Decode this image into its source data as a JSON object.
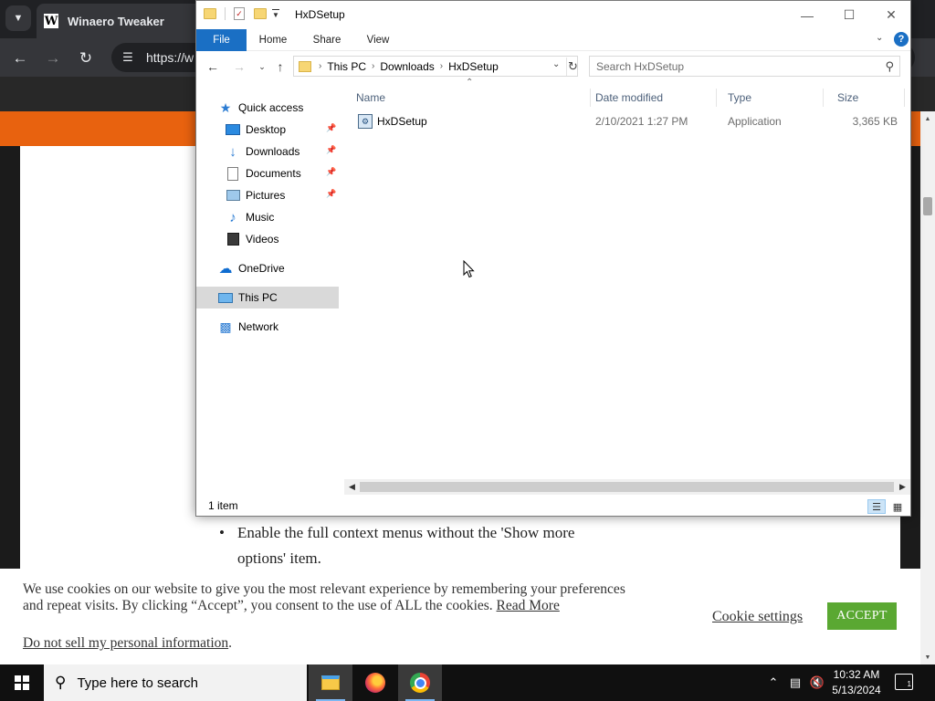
{
  "browser": {
    "tab_title": "Winaero Tweaker",
    "tab_logo_letter": "W",
    "url": "https://w",
    "nav_icons": [
      "back-arrow-icon",
      "forward-arrow-icon",
      "reload-icon",
      "site-info-icon"
    ]
  },
  "webpage": {
    "bullets": [
      "Enable the full context menus without the 'Show more options' item."
    ]
  },
  "cookie": {
    "text": "We use cookies on our website to give you the most relevant experience by remembering your preferences and repeat visits. By clicking “Accept”, you consent to the use of ALL the cookies.",
    "read_more": "Read More",
    "period": ".",
    "do_not_sell": "Do not sell my personal information",
    "settings": "Cookie settings",
    "accept": "ACCEPT",
    "accept_color": "#5aa832"
  },
  "explorer": {
    "title": "HxDSetup",
    "ribbon_tabs": [
      "File",
      "Home",
      "Share",
      "View"
    ],
    "file_tab_color": "#1a6fc4",
    "help_glyph": "?",
    "breadcrumb": [
      "This PC",
      "Downloads",
      "HxDSetup"
    ],
    "search_placeholder": "Search HxDSetup",
    "nav_pane": [
      {
        "label": "Quick access",
        "icon": "star-icon",
        "pinned": false,
        "selected": false
      },
      {
        "label": "Desktop",
        "icon": "desktop-icon",
        "pinned": true,
        "selected": false
      },
      {
        "label": "Downloads",
        "icon": "download-arrow-icon",
        "pinned": true,
        "selected": false
      },
      {
        "label": "Documents",
        "icon": "document-icon",
        "pinned": true,
        "selected": false
      },
      {
        "label": "Pictures",
        "icon": "picture-icon",
        "pinned": true,
        "selected": false
      },
      {
        "label": "Music",
        "icon": "music-note-icon",
        "pinned": false,
        "selected": false
      },
      {
        "label": "Videos",
        "icon": "video-icon",
        "pinned": false,
        "selected": false
      },
      {
        "label": "OneDrive",
        "icon": "cloud-icon",
        "pinned": false,
        "selected": false
      },
      {
        "label": "This PC",
        "icon": "computer-icon",
        "pinned": false,
        "selected": true
      },
      {
        "label": "Network",
        "icon": "network-icon",
        "pinned": false,
        "selected": false
      }
    ],
    "columns": [
      "Name",
      "Date modified",
      "Type",
      "Size"
    ],
    "files": [
      {
        "name": "HxDSetup",
        "date": "2/10/2021 1:27 PM",
        "type": "Application",
        "size": "3,365 KB",
        "icon": "application-icon"
      }
    ],
    "status": "1 item"
  },
  "taskbar": {
    "search_placeholder": "Type here to search",
    "apps": [
      "file-explorer-icon",
      "firefox-icon",
      "chrome-icon"
    ],
    "time": "10:32 AM",
    "date": "5/13/2024",
    "notification_count": "1"
  }
}
